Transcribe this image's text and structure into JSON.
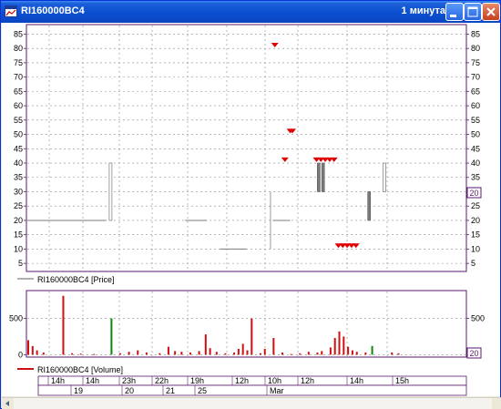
{
  "window": {
    "title": "RI160000BC4",
    "interval": "1 минута",
    "buttons": {
      "minimize": "minimize",
      "maximize": "maximize",
      "close": "close"
    }
  },
  "price_panel": {
    "legend": "RI160000BC4 [Price]",
    "y_ticks": [
      5,
      10,
      15,
      20,
      25,
      30,
      35,
      40,
      45,
      50,
      55,
      60,
      65,
      70,
      75,
      80,
      85
    ],
    "last_value_badge": "20",
    "ylim": [
      2.5,
      88
    ]
  },
  "volume_panel": {
    "legend": "RI160000BC4 [Volume]",
    "y_ticks": [
      0,
      500
    ],
    "last_value_badge": "20",
    "ylim": [
      -20,
      870
    ]
  },
  "time_axis": {
    "hours": [
      "14h",
      "14h",
      "23h",
      "22h",
      "19h",
      "12h",
      "10h",
      "12h",
      "14h",
      "15h"
    ],
    "dates": [
      "19",
      "20",
      "21",
      "25",
      "Mar"
    ]
  },
  "colors": {
    "panel_border": "#5a1a6c",
    "grid": "#8a8a8a",
    "volume_bar": "#d01010",
    "volume_bar_highlight": "#0a8a0a",
    "marker": "#e00000"
  },
  "chart_data": [
    {
      "type": "bar",
      "name": "price",
      "segments": [
        {
          "x0": 0.0,
          "x1": 0.18,
          "y": 20
        },
        {
          "x0": 0.36,
          "x1": 0.41,
          "y": 20
        },
        {
          "x0": 0.44,
          "x1": 0.5,
          "y": 10
        },
        {
          "x0": 0.56,
          "x1": 0.6,
          "y": 20
        }
      ],
      "candles": [
        {
          "x": 0.19,
          "open": 20,
          "close": 40,
          "hollow": true
        },
        {
          "x": 0.555,
          "open": 10,
          "close": 30,
          "hollow": false,
          "style": "line"
        },
        {
          "x": 0.665,
          "open": 30,
          "close": 40,
          "hollow": false
        },
        {
          "x": 0.675,
          "open": 30,
          "close": 40,
          "hollow": false
        },
        {
          "x": 0.78,
          "open": 20,
          "close": 30,
          "hollow": false
        },
        {
          "x": 0.815,
          "open": 30,
          "close": 40,
          "hollow": true
        }
      ],
      "markers": [
        {
          "x": 0.565,
          "y": 81
        },
        {
          "x": 0.588,
          "y": 41
        },
        {
          "x": 0.6,
          "y": 51
        },
        {
          "x": 0.605,
          "y": 51
        },
        {
          "x": 0.66,
          "y": 41
        },
        {
          "x": 0.67,
          "y": 41
        },
        {
          "x": 0.68,
          "y": 41
        },
        {
          "x": 0.69,
          "y": 41
        },
        {
          "x": 0.7,
          "y": 41
        },
        {
          "x": 0.71,
          "y": 11
        },
        {
          "x": 0.72,
          "y": 11
        },
        {
          "x": 0.73,
          "y": 11
        },
        {
          "x": 0.74,
          "y": 11
        },
        {
          "x": 0.75,
          "y": 11
        }
      ]
    },
    {
      "type": "bar",
      "name": "volume",
      "bars": [
        {
          "x": 0.0,
          "v": 200
        },
        {
          "x": 0.01,
          "v": 120
        },
        {
          "x": 0.02,
          "v": 60
        },
        {
          "x": 0.035,
          "v": 30
        },
        {
          "x": 0.08,
          "v": 810
        },
        {
          "x": 0.1,
          "v": 20
        },
        {
          "x": 0.12,
          "v": 15
        },
        {
          "x": 0.15,
          "v": 10
        },
        {
          "x": 0.19,
          "v": 500,
          "green": true
        },
        {
          "x": 0.21,
          "v": 20
        },
        {
          "x": 0.23,
          "v": 40
        },
        {
          "x": 0.25,
          "v": 60
        },
        {
          "x": 0.27,
          "v": 30
        },
        {
          "x": 0.3,
          "v": 20
        },
        {
          "x": 0.32,
          "v": 110
        },
        {
          "x": 0.335,
          "v": 50
        },
        {
          "x": 0.35,
          "v": 40
        },
        {
          "x": 0.37,
          "v": 30
        },
        {
          "x": 0.39,
          "v": 50
        },
        {
          "x": 0.405,
          "v": 280
        },
        {
          "x": 0.415,
          "v": 90
        },
        {
          "x": 0.43,
          "v": 40
        },
        {
          "x": 0.45,
          "v": 20
        },
        {
          "x": 0.47,
          "v": 30
        },
        {
          "x": 0.48,
          "v": 80
        },
        {
          "x": 0.49,
          "v": 150
        },
        {
          "x": 0.5,
          "v": 60
        },
        {
          "x": 0.51,
          "v": 500
        },
        {
          "x": 0.53,
          "v": 20
        },
        {
          "x": 0.54,
          "v": 80
        },
        {
          "x": 0.56,
          "v": 230
        },
        {
          "x": 0.58,
          "v": 30
        },
        {
          "x": 0.6,
          "v": 10
        },
        {
          "x": 0.62,
          "v": 20
        },
        {
          "x": 0.64,
          "v": 40
        },
        {
          "x": 0.66,
          "v": 30
        },
        {
          "x": 0.67,
          "v": 50
        },
        {
          "x": 0.69,
          "v": 100
        },
        {
          "x": 0.7,
          "v": 230
        },
        {
          "x": 0.71,
          "v": 320
        },
        {
          "x": 0.72,
          "v": 250
        },
        {
          "x": 0.73,
          "v": 110
        },
        {
          "x": 0.74,
          "v": 60
        },
        {
          "x": 0.75,
          "v": 40
        },
        {
          "x": 0.77,
          "v": 30
        },
        {
          "x": 0.785,
          "v": 120,
          "green": true
        },
        {
          "x": 0.83,
          "v": 30
        },
        {
          "x": 0.845,
          "v": 20
        }
      ]
    }
  ]
}
